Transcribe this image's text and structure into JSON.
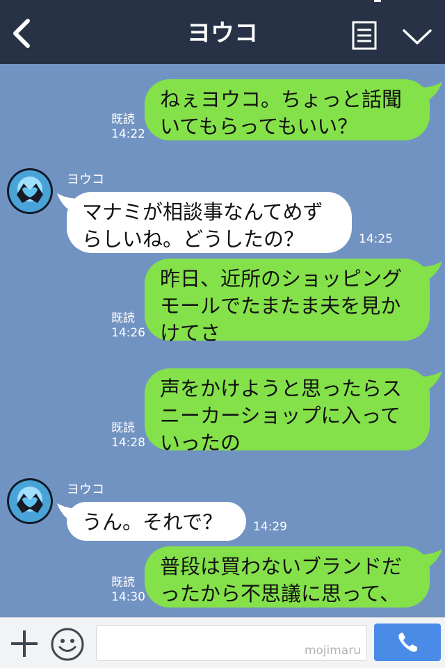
{
  "header": {
    "title": "ヨウコ"
  },
  "messages": [
    {
      "dir": "out",
      "text_lines": [
        "ねぇヨウコ。ちょっと話聞",
        "いてもらってもいい？"
      ],
      "read": "既読",
      "time": "14:22"
    },
    {
      "dir": "in",
      "sender": "ヨウコ",
      "text_lines": [
        "マナミが相談事なんてめず",
        "らしいね。どうしたの？"
      ],
      "time": "14:25"
    },
    {
      "dir": "out",
      "text_lines": [
        "昨日、近所のショッピング",
        "モールでたまたま夫を見か",
        "けてさ"
      ],
      "read": "既読",
      "time": "14:26"
    },
    {
      "dir": "out",
      "text_lines": [
        "声をかけようと思ったらス",
        "ニーカーショップに入って",
        "いったの"
      ],
      "read": "既読",
      "time": "14:28"
    },
    {
      "dir": "in",
      "sender": "ヨウコ",
      "text_lines": [
        "うん。それで？"
      ],
      "time": "14:29"
    },
    {
      "dir": "out",
      "text_lines": [
        "普段は買わないブランドだ",
        "ったから不思議に思って、"
      ],
      "read": "既読",
      "time": "14:30"
    }
  ],
  "input": {
    "watermark": "mojimaru",
    "value": ""
  },
  "icons": {
    "back": "chevron-left-icon",
    "menu": "document-menu-icon",
    "collapse": "chevron-down-icon",
    "plus": "plus-icon",
    "emoji": "smiley-icon",
    "call": "phone-icon"
  },
  "colors": {
    "header": "#273246",
    "chat_bg": "#7193c2",
    "out_bubble": "#84e14a",
    "in_bubble": "#ffffff",
    "send": "#4b8be8"
  }
}
